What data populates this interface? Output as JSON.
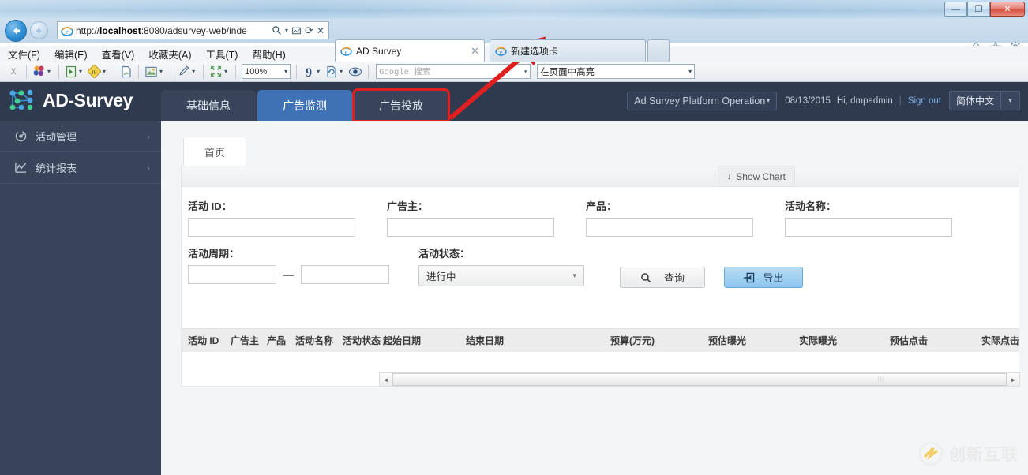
{
  "browser": {
    "window_controls": {
      "minimize": "—",
      "restore": "❐",
      "close": "✕"
    },
    "address": {
      "url_prefix": "http://",
      "url_host": "localhost",
      "url_rest": ":8080/adsurvey-web/inde"
    },
    "address_icons": {
      "search": "search-icon",
      "dropdown": "▾",
      "compat": "compat-icon",
      "refresh": "⟳",
      "stop": "✕"
    },
    "tabs": [
      {
        "label": "AD Survey",
        "active": true,
        "close": "✕"
      },
      {
        "label": "新建选项卡",
        "active": false
      }
    ],
    "newtab_button": "",
    "tools": {
      "home": "⌂",
      "favorites": "★",
      "settings": "⚙"
    },
    "menu": [
      "文件(F)",
      "编辑(E)",
      "查看(V)",
      "收藏夹(A)",
      "工具(T)",
      "帮助(H)"
    ],
    "devbar": {
      "close_x": "X",
      "zoom": "100%",
      "search_placeholder": "Google 搜索",
      "highlight": "在页面中高亮",
      "caret": "▾"
    }
  },
  "app": {
    "logo_text": "AD-Survey",
    "main_tabs": [
      {
        "label": "基础信息",
        "state": "normal"
      },
      {
        "label": "广告监测",
        "state": "active"
      },
      {
        "label": "广告投放",
        "state": "highlight"
      }
    ],
    "header_right": {
      "platform": "Ad Survey Platform Operation",
      "platform_caret": "▾",
      "date": "08/13/2015",
      "greeting": "Hi, dmpadmin",
      "separator": "|",
      "sign_out": "Sign out",
      "language": "简体中文",
      "language_caret": "▾"
    },
    "sidebar": [
      {
        "label": "活动管理",
        "icon": "campaign-icon",
        "chevron": "›"
      },
      {
        "label": "统计报表",
        "icon": "chart-line-icon",
        "chevron": "›"
      }
    ],
    "inner_tabs": [
      {
        "label": "首页",
        "active": true
      }
    ],
    "show_chart": {
      "label": "Show Chart",
      "icon": "↓"
    },
    "form": {
      "campaign_id": {
        "label": "活动 ID：",
        "value": "",
        "placeholder": ""
      },
      "advertiser": {
        "label": "广告主：",
        "value": "",
        "placeholder": ""
      },
      "product": {
        "label": "产品：",
        "value": "",
        "placeholder": ""
      },
      "campaign_name": {
        "label": "活动名称：",
        "value": "",
        "placeholder": ""
      },
      "period": {
        "label": "活动周期：",
        "start": "",
        "end": "",
        "dash": "—"
      },
      "status": {
        "label": "活动状态：",
        "value": "进行中",
        "caret": "▾"
      }
    },
    "buttons": {
      "search": {
        "label": "查询",
        "icon": "magnifier-icon"
      },
      "export": {
        "label": "导出",
        "icon": "export-arrow-icon"
      }
    },
    "table": {
      "columns": [
        "活动 ID",
        "广告主",
        "产品",
        "活动名称",
        "活动状态",
        "起始日期",
        "结束日期",
        "预算(万元)",
        "预估曝光",
        "实际曝光",
        "预估点击",
        "实际点击"
      ],
      "rows": [],
      "scrollbar": {
        "left_arrow": "◄",
        "right_arrow": "►",
        "grip": "⦙⦙⦙"
      }
    }
  },
  "watermark": {
    "text": "创新互联"
  }
}
